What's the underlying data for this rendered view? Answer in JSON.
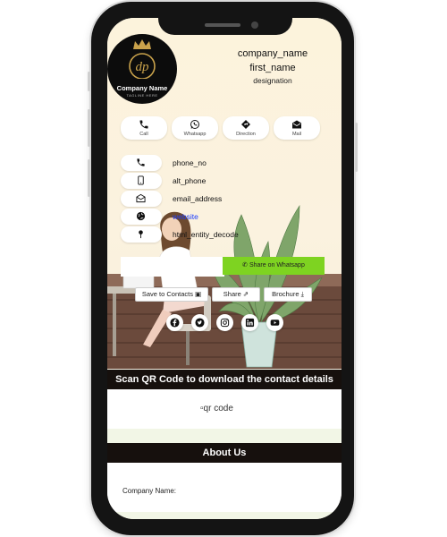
{
  "header": {
    "company_name": "company_name",
    "first_name": "first_name",
    "designation": "designation",
    "logo": {
      "name": "Company Name",
      "tagline": "TAGLINE HERE",
      "monogram": "dp",
      "icon": "crown-icon",
      "accent": "#c9a24b"
    }
  },
  "actions": [
    {
      "label": "Call",
      "icon": "phone-icon"
    },
    {
      "label": "Whatsapp",
      "icon": "whatsapp-icon"
    },
    {
      "label": "Direction",
      "icon": "direction-icon"
    },
    {
      "label": "Mail",
      "icon": "mail-icon"
    }
  ],
  "contact": {
    "phone": "phone_no",
    "alt_phone": "alt_phone",
    "email": "email_address",
    "website": "website",
    "address": "html_entity_decode"
  },
  "share": {
    "input_placeholder": "",
    "button_label": "Share on Whatsapp",
    "button_color": "#7ed321"
  },
  "buttons": {
    "save": "Save to Contacts",
    "share": "Share",
    "brochure": "Brochure"
  },
  "social": [
    "facebook-icon",
    "twitter-icon",
    "instagram-icon",
    "linkedin-icon",
    "youtube-icon"
  ],
  "qr": {
    "title": "Scan QR Code to download the contact details",
    "alt": "qr code"
  },
  "about": {
    "title": "About Us",
    "company_label": "Company Name:"
  },
  "colors": {
    "section_header": "#16100d",
    "background": "#fbf6e9",
    "strip": "#f2f6e6"
  }
}
